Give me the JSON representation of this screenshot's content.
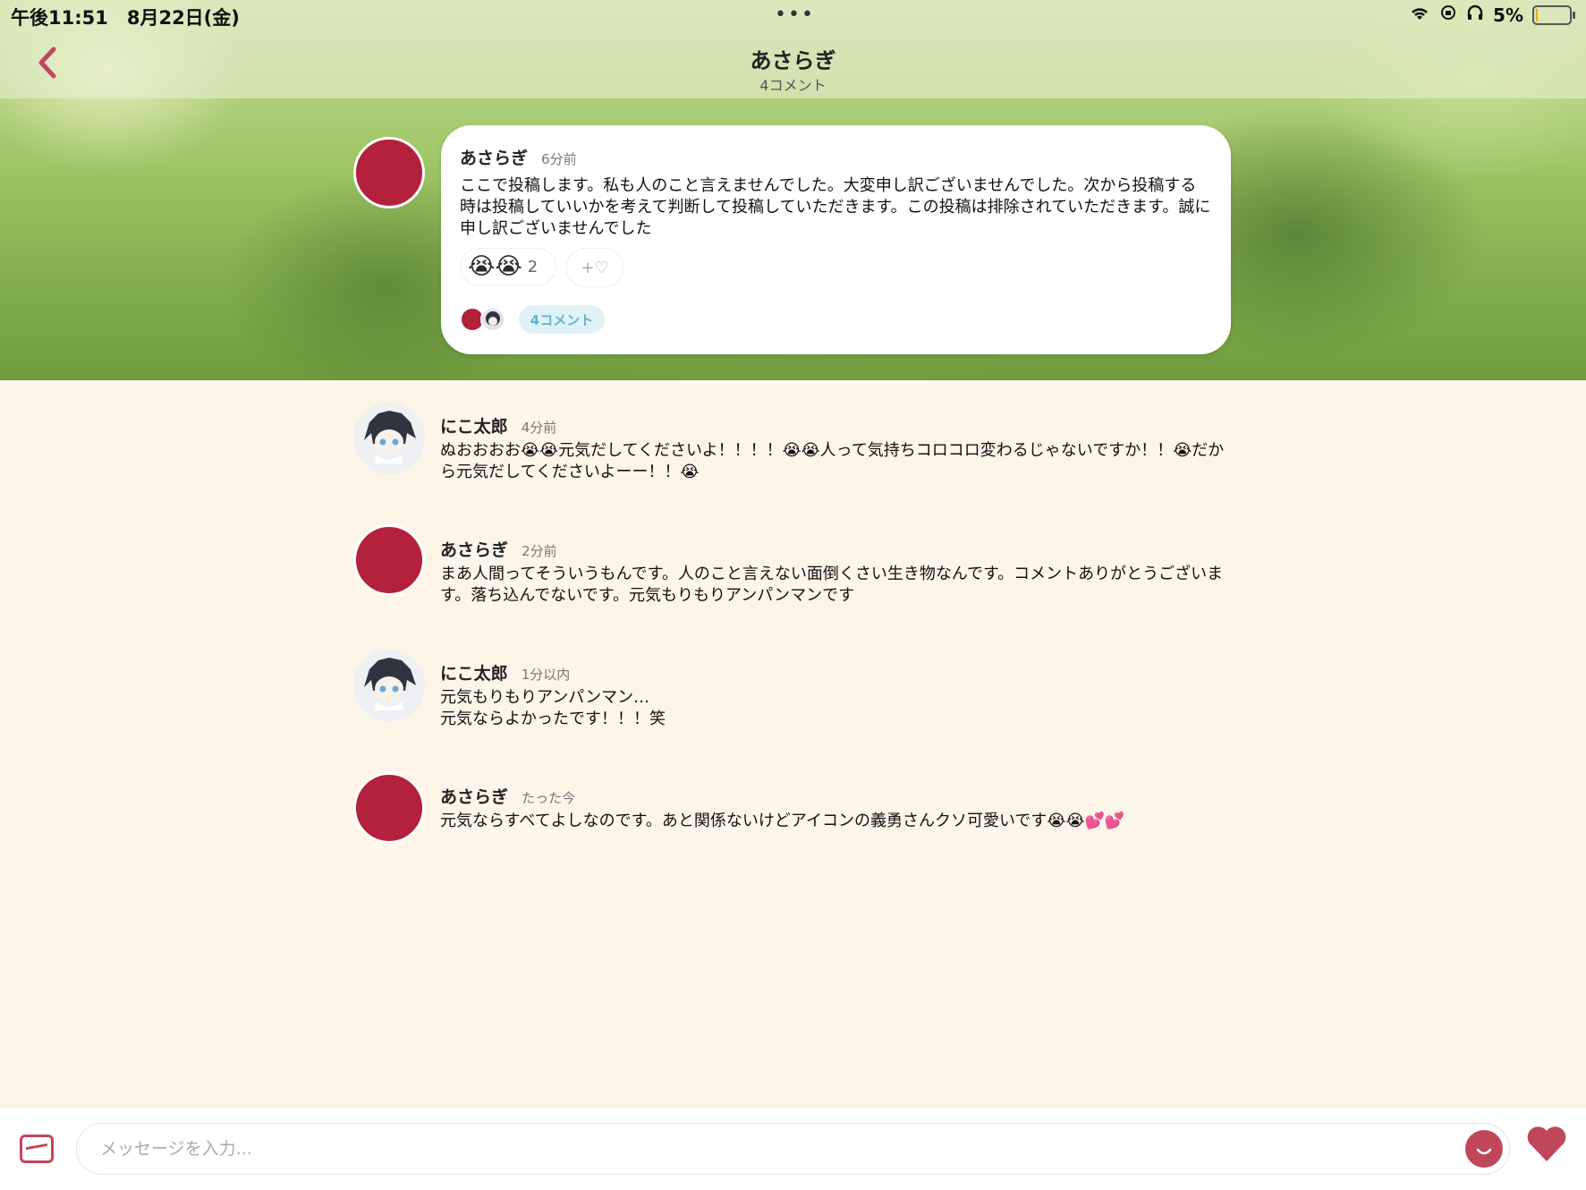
{
  "status": {
    "time": "午後11:51　8月22日(金)",
    "dots": "•••",
    "battery": "5%"
  },
  "header": {
    "back_icon": "chevron-left-icon",
    "title": "あさらぎ",
    "subtitle": "4コメント"
  },
  "post": {
    "author": "あさらぎ",
    "time": "6分前",
    "text": "ここで投稿します。私も人のこと言えませんでした。大変申し訳ございませんでした。次から投稿する時は投稿していいかを考えて判断して投稿していただきます。この投稿は排除されていただきます。誠に申し訳ございませんでした",
    "reaction_emoji": "😭😭",
    "reaction_count": "2",
    "add_reaction": "+♡",
    "comments_label": "4コメント"
  },
  "comments": [
    {
      "author": "にこ太郎",
      "time": "4分前",
      "text": "ぬおおおお😭😭元気だしてくださいよ！！！！😭😭人って気持ちコロコロ変わるじゃないですか！！😭だから元気だしてくださいよーー！！😭"
    },
    {
      "author": "あさらぎ",
      "time": "2分前",
      "text": "まあ人間ってそういうもんです。人のこと言えない面倒くさい生き物なんです。コメントありがとうございます。落ち込んでないです。元気もりもりアンパンマンです"
    },
    {
      "author": "にこ太郎",
      "time": "1分以内",
      "text": "元気もりもりアンパンマン…\n元気ならよかったです！！！笑"
    },
    {
      "author": "あさらぎ",
      "time": "たった今",
      "text": "元気ならすべてよしなのです。あと関係ないけどアイコンの義勇さんクソ可愛いです😭😭💕💕"
    }
  ],
  "composer": {
    "placeholder": "メッセージを入力..."
  },
  "colors": {
    "accent": "#c0475a",
    "avatar_red": "#b3213d",
    "background": "#fdf5e8",
    "link": "#5bb7d3"
  }
}
